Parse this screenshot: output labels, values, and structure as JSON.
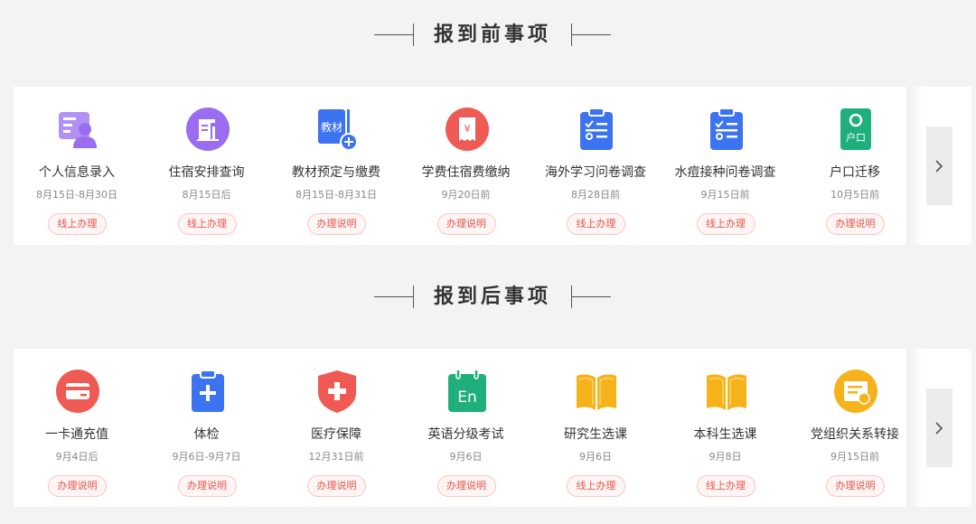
{
  "before": {
    "title": "报到前事项",
    "items": [
      {
        "name": "个人信息录入",
        "date": "8月15日-8月30日",
        "action": "线上办理",
        "icon": "user-info-card-icon",
        "color": "#9a6cf0"
      },
      {
        "name": "住宿安排查询",
        "date": "8月15日后",
        "action": "线上办理",
        "icon": "dorm-document-icon",
        "color": "#9a6cf0"
      },
      {
        "name": "教材预定与缴费",
        "date": "8月15日-8月31日",
        "action": "办理说明",
        "icon": "textbook-add-icon",
        "color": "#3b73f0"
      },
      {
        "name": "学费住宿费缴纳",
        "date": "9月20日前",
        "action": "办理说明",
        "icon": "yuan-receipt-icon",
        "color": "#f05a55"
      },
      {
        "name": "海外学习问卷调查",
        "date": "8月28日前",
        "action": "线上办理",
        "icon": "clipboard-checklist-icon",
        "color": "#3b73f0"
      },
      {
        "name": "水痘接种问卷调查",
        "date": "9月15日前",
        "action": "线上办理",
        "icon": "clipboard-checklist-icon",
        "color": "#3b73f0"
      },
      {
        "name": "户口迁移",
        "date": "10月5日前",
        "action": "办理说明",
        "icon": "hukou-id-icon",
        "color": "#1faf7a",
        "label": "户口"
      }
    ]
  },
  "after": {
    "title": "报到后事项",
    "items": [
      {
        "name": "一卡通充值",
        "date": "9月4日后",
        "action": "办理说明",
        "icon": "card-icon",
        "color": "#f05a55"
      },
      {
        "name": "体检",
        "date": "9月6日-9月7日",
        "action": "办理说明",
        "icon": "medical-clipboard-icon",
        "color": "#3b73f0"
      },
      {
        "name": "医疗保障",
        "date": "12月31日前",
        "action": "办理说明",
        "icon": "medical-shield-icon",
        "color": "#f05a55"
      },
      {
        "name": "英语分级考试",
        "date": "9月6日",
        "action": "办理说明",
        "icon": "english-calendar-icon",
        "color": "#1faf7a",
        "label": "En"
      },
      {
        "name": "研究生选课",
        "date": "9月6日",
        "action": "线上办理",
        "icon": "open-book-icon",
        "color": "#f6b21a"
      },
      {
        "name": "本科生选课",
        "date": "9月8日",
        "action": "线上办理",
        "icon": "open-book-icon",
        "color": "#f6b21a"
      },
      {
        "name": "党组织关系转接",
        "date": "9月15日前",
        "action": "办理说明",
        "icon": "transfer-document-icon",
        "color": "#f6b21a"
      }
    ]
  },
  "next_icon": "chevron-right-icon",
  "colors": {
    "accent": "#e2574c",
    "background": "#f3f3f3"
  }
}
